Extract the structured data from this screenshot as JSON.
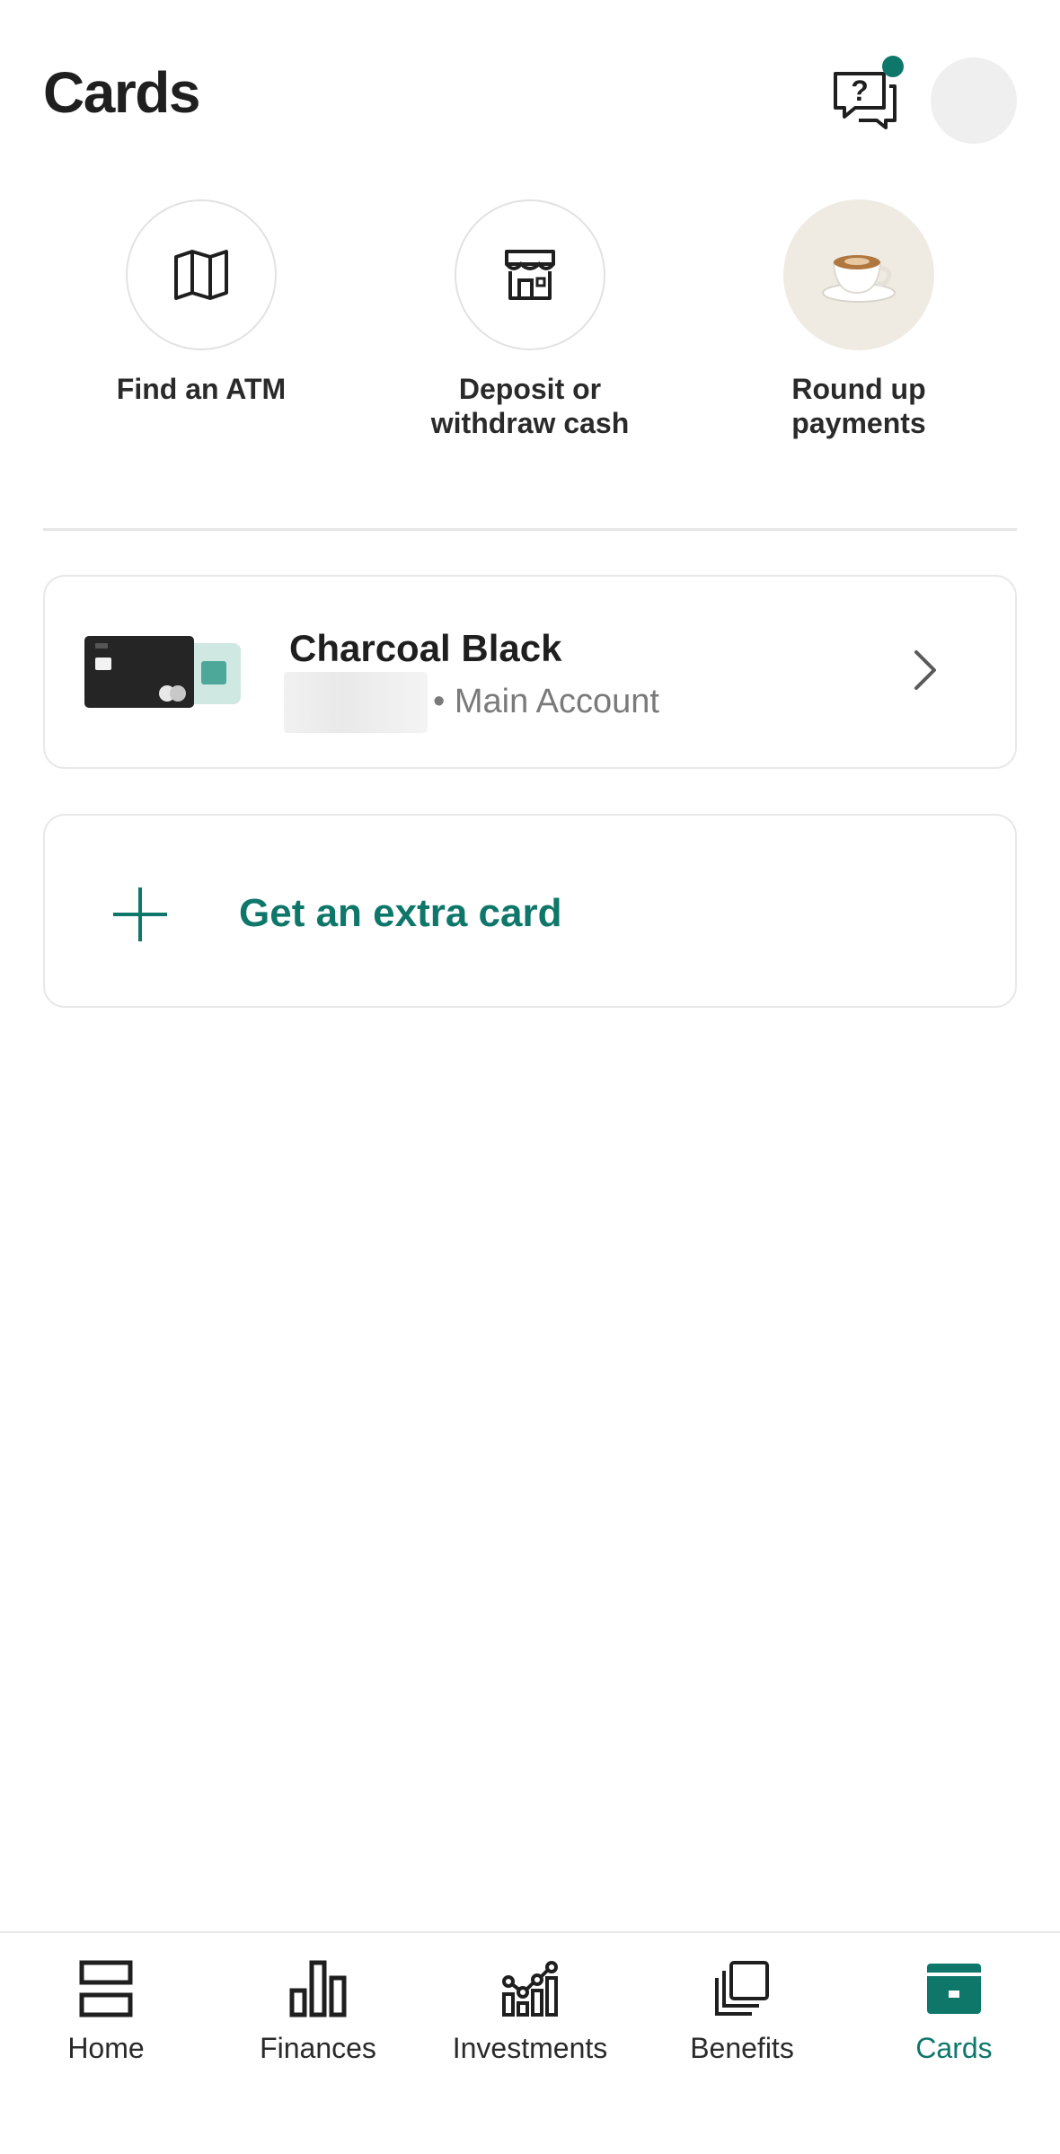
{
  "header": {
    "title": "Cards",
    "help_icon": "question-chat-icon",
    "avatar_icon": "avatar"
  },
  "quick_actions": [
    {
      "label": "Find an ATM",
      "icon": "map-icon"
    },
    {
      "label": "Deposit or withdraw cash",
      "icon": "store-icon"
    },
    {
      "label": "Round up payments",
      "icon": "coffee-cup-icon"
    }
  ],
  "card": {
    "name": "Charcoal Black",
    "account": "• Main Account",
    "icon": "card-thumbnail",
    "chevron": "chevron-right-icon"
  },
  "extra_card": {
    "label": "Get an extra card",
    "icon": "plus-icon"
  },
  "tabs": [
    {
      "label": "Home",
      "icon": "home-icon",
      "active": false
    },
    {
      "label": "Finances",
      "icon": "bar-chart-icon",
      "active": false
    },
    {
      "label": "Investments",
      "icon": "investments-icon",
      "active": false
    },
    {
      "label": "Benefits",
      "icon": "benefits-icon",
      "active": false
    },
    {
      "label": "Cards",
      "icon": "card-icon",
      "active": true
    }
  ],
  "colors": {
    "accent": "#0e776a",
    "text": "#1f1f1f",
    "muted": "#7a7a7a",
    "border": "#e8e8e8",
    "coffee_bg": "#efebe2"
  }
}
